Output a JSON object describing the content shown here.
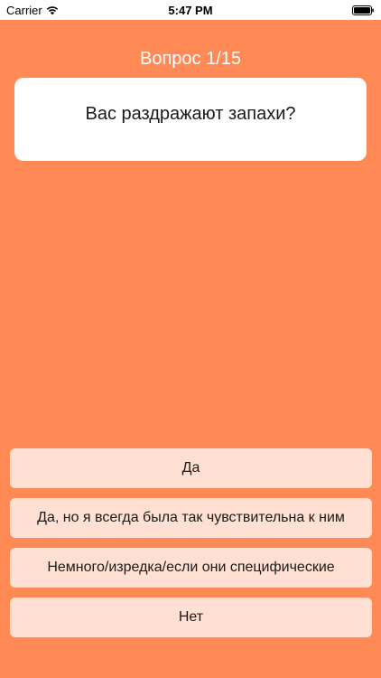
{
  "status_bar": {
    "carrier": "Carrier",
    "time": "5:47 PM"
  },
  "quiz": {
    "counter": "Вопрос 1/15",
    "question": "Вас раздражают запахи?",
    "answers": [
      {
        "label": "Да"
      },
      {
        "label": "Да, но я всегда была так чувствительна к ним"
      },
      {
        "label": "Немного/изредка/если они специфические"
      },
      {
        "label": "Нет"
      }
    ]
  },
  "colors": {
    "background": "#ff8a55",
    "card": "#ffffff",
    "answer_button": "#ffe0d2"
  }
}
